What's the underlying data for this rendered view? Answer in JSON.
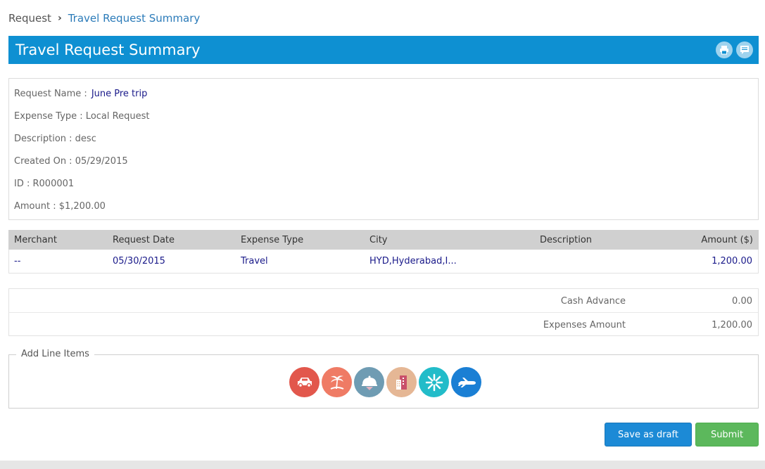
{
  "breadcrumb": {
    "root": "Request",
    "current": "Travel Request Summary"
  },
  "header": {
    "title": "Travel Request Summary",
    "icons": [
      "print-icon",
      "comment-icon"
    ]
  },
  "summary": {
    "request_name_label": "Request Name :",
    "request_name_value": "June Pre trip",
    "expense_type": "Expense Type : Local Request",
    "description": "Description : desc",
    "created_on": "Created On : 05/29/2015",
    "id": "ID : R000001",
    "amount": "Amount : $1,200.00"
  },
  "table": {
    "headers": [
      "Merchant",
      "Request Date",
      "Expense Type",
      "City",
      "Description",
      "Amount ($)"
    ],
    "rows": [
      [
        "--",
        "05/30/2015",
        "Travel",
        "HYD,Hyderabad,I...",
        "",
        "1,200.00"
      ]
    ]
  },
  "totals": {
    "cash_advance_label": "Cash Advance",
    "cash_advance_value": "0.00",
    "expenses_amount_label": "Expenses Amount",
    "expenses_amount_value": "1,200.00"
  },
  "line_items": {
    "legend": "Add Line Items",
    "icons": [
      {
        "name": "car-icon",
        "color": "#e2574c"
      },
      {
        "name": "beach-icon",
        "color": "#ef7b65"
      },
      {
        "name": "meal-icon",
        "color": "#6f9cb3"
      },
      {
        "name": "hotel-icon",
        "color": "#e5b795"
      },
      {
        "name": "misc-icon",
        "color": "#22bcc9"
      },
      {
        "name": "flight-icon",
        "color": "#1a7fd4"
      }
    ]
  },
  "buttons": {
    "save_draft": "Save as draft",
    "submit": "Submit"
  },
  "colors": {
    "accent": "#0e90d2",
    "link": "#1a1a8a",
    "submit": "#5cb85c",
    "draft": "#1c8ad6"
  }
}
